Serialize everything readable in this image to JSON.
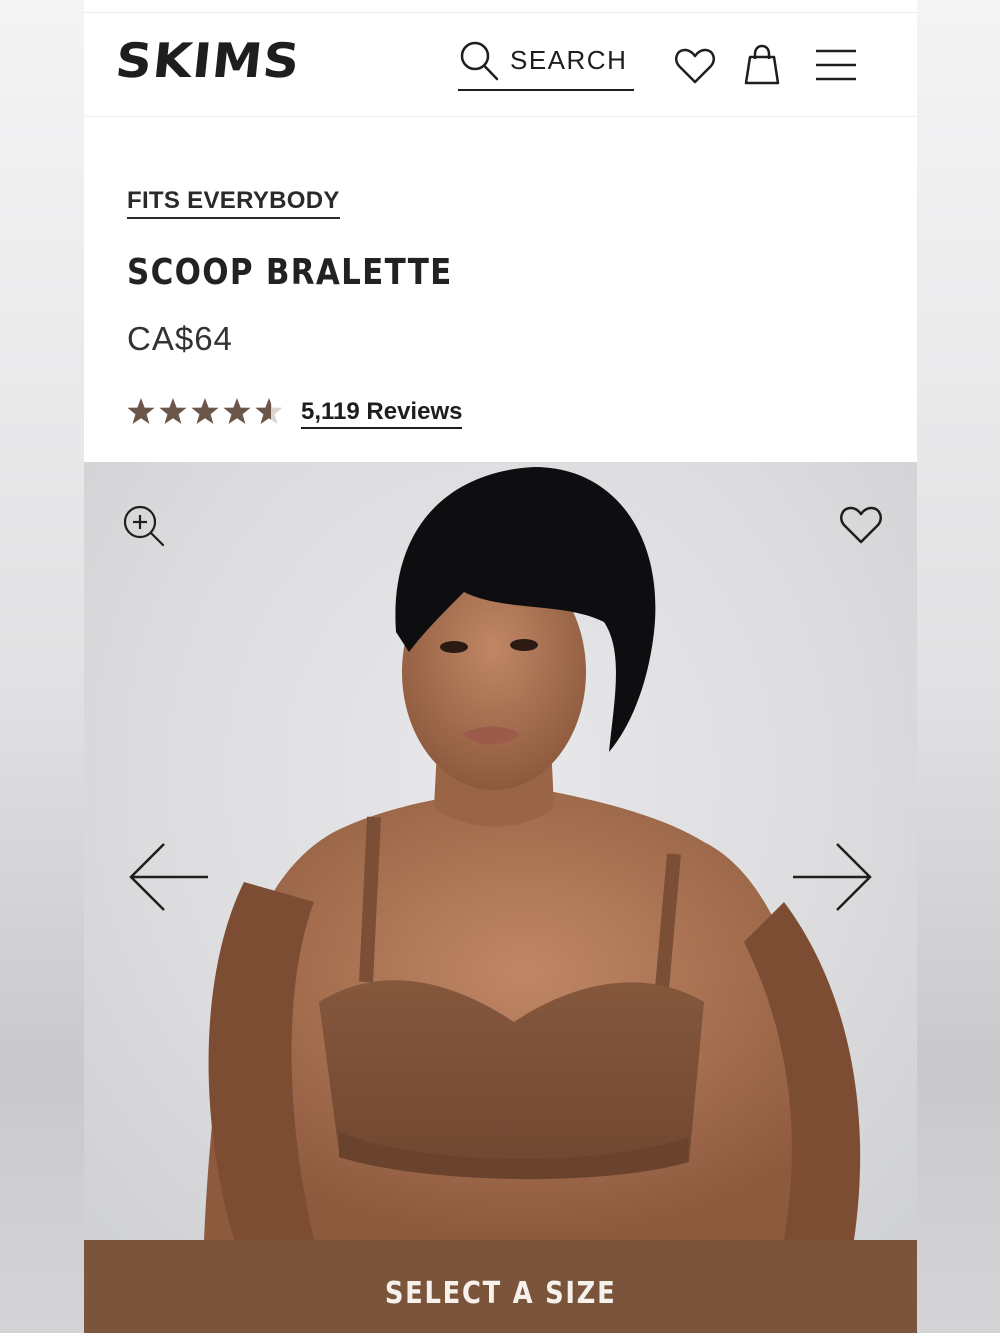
{
  "header": {
    "logo_text": "SKIMS",
    "search_label": "SEARCH"
  },
  "product": {
    "collection": "FITS EVERYBODY",
    "title": "SCOOP BRALETTE",
    "price": "CA$64",
    "rating": 4.5,
    "rating_max": 5,
    "reviews_label": "5,119 Reviews"
  },
  "gallery": {
    "image_subject": "model wearing brown scoop bralette"
  },
  "cta": {
    "label": "SELECT A SIZE"
  },
  "colors": {
    "brand_brown": "#7a553b",
    "star_color": "#6b574a",
    "text_dark": "#1e1e1e"
  },
  "icons": [
    "search-icon",
    "heart-icon",
    "bag-icon",
    "menu-icon",
    "zoom-in-icon",
    "arrow-left-icon",
    "arrow-right-icon",
    "star-icon"
  ]
}
